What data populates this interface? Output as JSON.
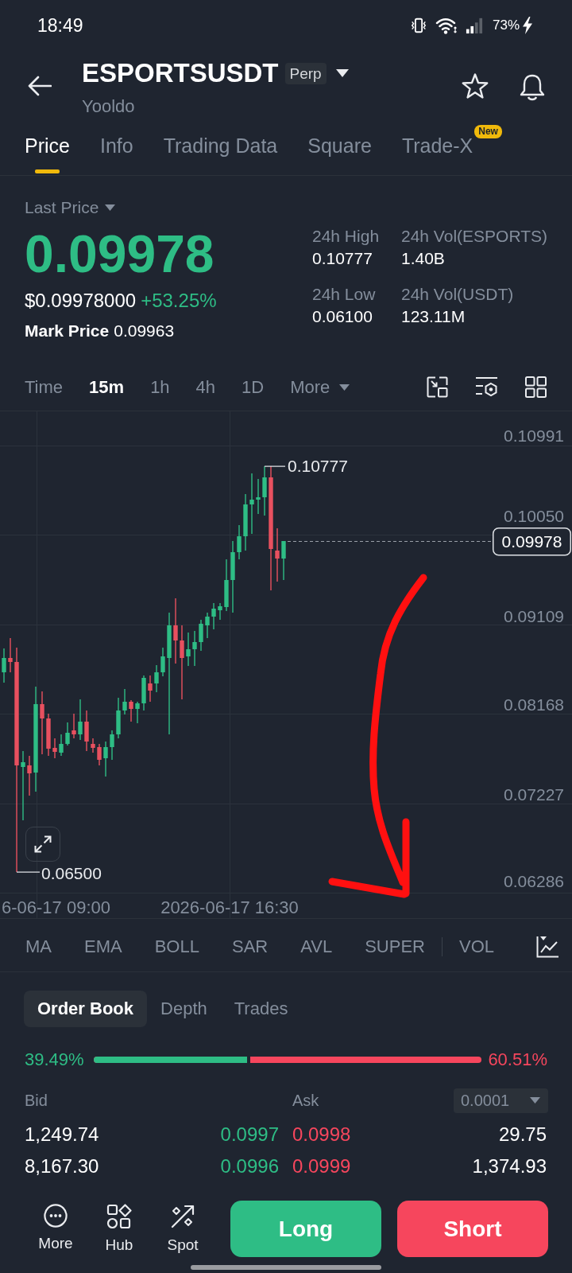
{
  "status_bar": {
    "time": "18:49",
    "battery": "73%"
  },
  "header": {
    "symbol": "ESPORTSUSDT",
    "contract": "Perp",
    "name": "Yooldo"
  },
  "tabs": [
    {
      "label": "Price",
      "selected": true
    },
    {
      "label": "Info",
      "selected": false
    },
    {
      "label": "Trading Data",
      "selected": false
    },
    {
      "label": "Square",
      "selected": false
    },
    {
      "label": "Trade-X",
      "selected": false,
      "badge": "New"
    }
  ],
  "price": {
    "label": "Last Price",
    "last": "0.09978",
    "usd": "$0.09978000",
    "change": "+53.25%",
    "mark_label": "Mark Price",
    "mark": "0.09963"
  },
  "stats": [
    {
      "label": "24h High",
      "value": "0.10777"
    },
    {
      "label": "24h Vol(ESPORTS)",
      "value": "1.40B"
    },
    {
      "label": "24h Low",
      "value": "0.06100"
    },
    {
      "label": "24h Vol(USDT)",
      "value": "123.11M"
    }
  ],
  "intervals": [
    {
      "label": "Time",
      "selected": false,
      "kind": "option"
    },
    {
      "label": "15m",
      "selected": true,
      "kind": "option"
    },
    {
      "label": "1h",
      "selected": false,
      "kind": "option"
    },
    {
      "label": "4h",
      "selected": false,
      "kind": "option"
    },
    {
      "label": "1D",
      "selected": false,
      "kind": "option"
    },
    {
      "label": "More",
      "selected": false,
      "kind": "menu"
    }
  ],
  "chart": {
    "price_axis": [
      "0.10991",
      "0.10050",
      "0.09109",
      "0.08168",
      "0.07227",
      "0.06286"
    ],
    "time_axis": [
      "6-06-17 09:00",
      "2026-06-17 16:30"
    ],
    "high_label": "0.10777",
    "low_label": "0.06500",
    "last_price_tag": "0.09978"
  },
  "indicators": {
    "main": [
      "MA",
      "EMA",
      "BOLL",
      "SAR",
      "AVL",
      "SUPER"
    ],
    "sub": [
      "VOL"
    ]
  },
  "book_tabs": [
    {
      "label": "Order Book",
      "selected": true
    },
    {
      "label": "Depth",
      "selected": false
    },
    {
      "label": "Trades",
      "selected": false
    }
  ],
  "ratio": {
    "bid": "39.49%",
    "ask": "60.51%",
    "level": 0.3949
  },
  "order_book": {
    "bid_header": "Bid",
    "ask_header": "Ask",
    "precision": "0.0001",
    "rows": [
      {
        "bid_qty": "1,249.74",
        "bid_price": "0.0997",
        "ask_price": "0.0998",
        "ask_qty": "29.75"
      },
      {
        "bid_qty": "8,167.30",
        "bid_price": "0.0996",
        "ask_price": "0.0999",
        "ask_qty": "1,374.93"
      }
    ]
  },
  "bottom_nav": [
    {
      "label": "More"
    },
    {
      "label": "Hub"
    },
    {
      "label": "Spot"
    }
  ],
  "actions": [
    {
      "label": "Long",
      "kind": "long"
    },
    {
      "label": "Short",
      "kind": "short"
    }
  ]
}
